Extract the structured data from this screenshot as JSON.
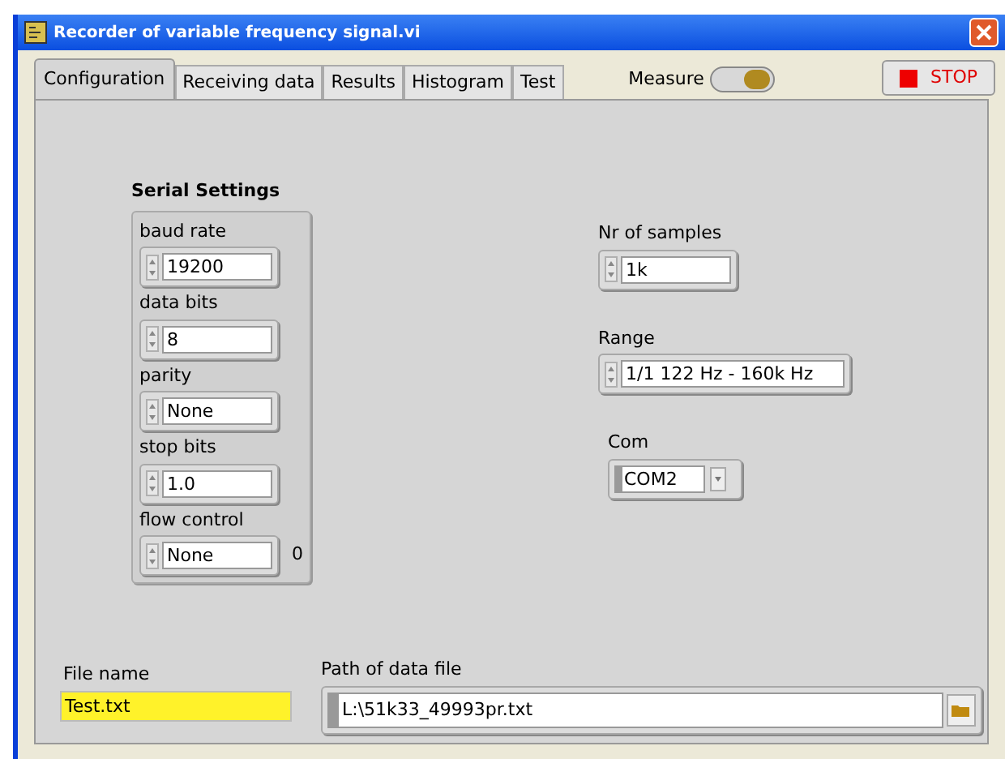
{
  "window": {
    "title": "Recorder of variable frequency signal.vi"
  },
  "tabs": [
    {
      "label": "Configuration",
      "selected": true
    },
    {
      "label": "Receiving data",
      "selected": false
    },
    {
      "label": "Results",
      "selected": false
    },
    {
      "label": "Histogram",
      "selected": false
    },
    {
      "label": "Test",
      "selected": false
    }
  ],
  "measure": {
    "label": "Measure",
    "on": true
  },
  "stop_button": {
    "label": "STOP"
  },
  "serial_settings": {
    "title": "Serial Settings",
    "fields": [
      {
        "label": "baud rate",
        "value": "19200"
      },
      {
        "label": "data bits",
        "value": "8"
      },
      {
        "label": "parity",
        "value": "None"
      },
      {
        "label": "stop bits",
        "value": "1.0"
      },
      {
        "label": "flow control",
        "value": "None",
        "indicator": "0"
      }
    ]
  },
  "right_controls": [
    {
      "kind": "spin",
      "label": "Nr of samples",
      "value": "1k"
    },
    {
      "kind": "spin",
      "label": "Range",
      "value": "1/1 122 Hz - 160k Hz"
    },
    {
      "kind": "dropdown",
      "label": "Com",
      "value": "COM2"
    }
  ],
  "file_name": {
    "label": "File name",
    "value": "Test.txt"
  },
  "data_path": {
    "label": "Path of data file",
    "value": "L:\\51k33_49993pr.txt"
  }
}
